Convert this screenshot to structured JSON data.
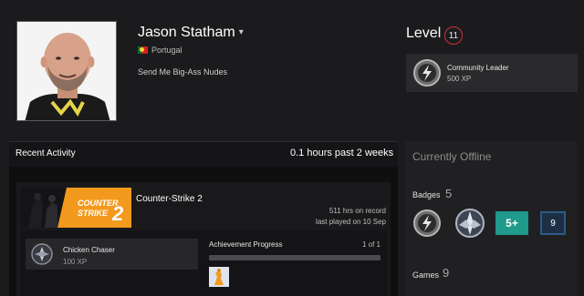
{
  "profile": {
    "name": "Jason Statham",
    "name_caret": "▾",
    "country": "Portugal",
    "summary": "Send Me Big-Ass Nudes"
  },
  "level": {
    "label": "Level",
    "value": "11"
  },
  "featured_badge": {
    "title": "Community Leader",
    "xp": "500 XP",
    "icon": "lightning-badge-icon"
  },
  "recent_activity": {
    "title": "Recent Activity",
    "hours": "0.1 hours past 2 weeks",
    "game": {
      "name": "Counter-Strike 2",
      "hours_on_record": "511 hrs on record",
      "last_played": "last played on 10 Sep",
      "capsule_text_line1": "COUNTER",
      "capsule_text_line2": "STRIKE",
      "capsule_number": "2"
    },
    "achievement": {
      "name": "Chicken Chaser",
      "xp": "100 XP",
      "icon": "achievement-icon"
    },
    "progress": {
      "label": "Achievement Progress",
      "count": "1 of 1",
      "fraction": 1.0
    }
  },
  "status": {
    "offline_text": "Currently Offline",
    "badges_label": "Badges",
    "badges_count": "5",
    "badge_icons": [
      "lightning-badge-icon",
      "wings-badge-icon",
      "five-plus-badge-icon",
      "years-badge-icon"
    ],
    "badge_five_text": "5+",
    "badge_nine_text": "9",
    "games_label": "Games",
    "games_count": "9"
  },
  "colors": {
    "background": "#1b1b1d",
    "level_ring": "#d0303a",
    "badge_teal": "#1f9a8b",
    "cs2_orange": "#f39a1e"
  }
}
